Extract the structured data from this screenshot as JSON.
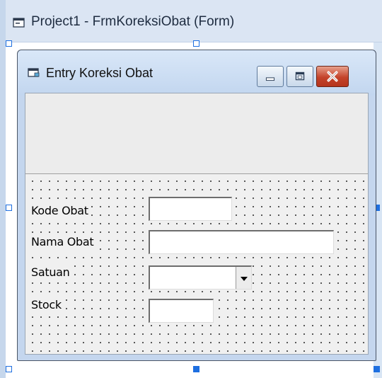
{
  "designer": {
    "title": "Project1 - FrmKoreksiObat (Form)",
    "icon": "form-icon"
  },
  "form": {
    "title": "Entry Koreksi Obat",
    "icon": "form-icon",
    "caption_buttons": [
      "minimize",
      "maximize",
      "close"
    ]
  },
  "fields": [
    {
      "label": "Kode Obat",
      "value": ""
    },
    {
      "label": "Nama Obat",
      "value": ""
    },
    {
      "label": "Satuan",
      "value": ""
    },
    {
      "label": "Stock",
      "value": ""
    }
  ],
  "colors": {
    "accent": "#1e6fe0",
    "close_button": "#c4432a",
    "form_bg": "#f0f0f0"
  }
}
